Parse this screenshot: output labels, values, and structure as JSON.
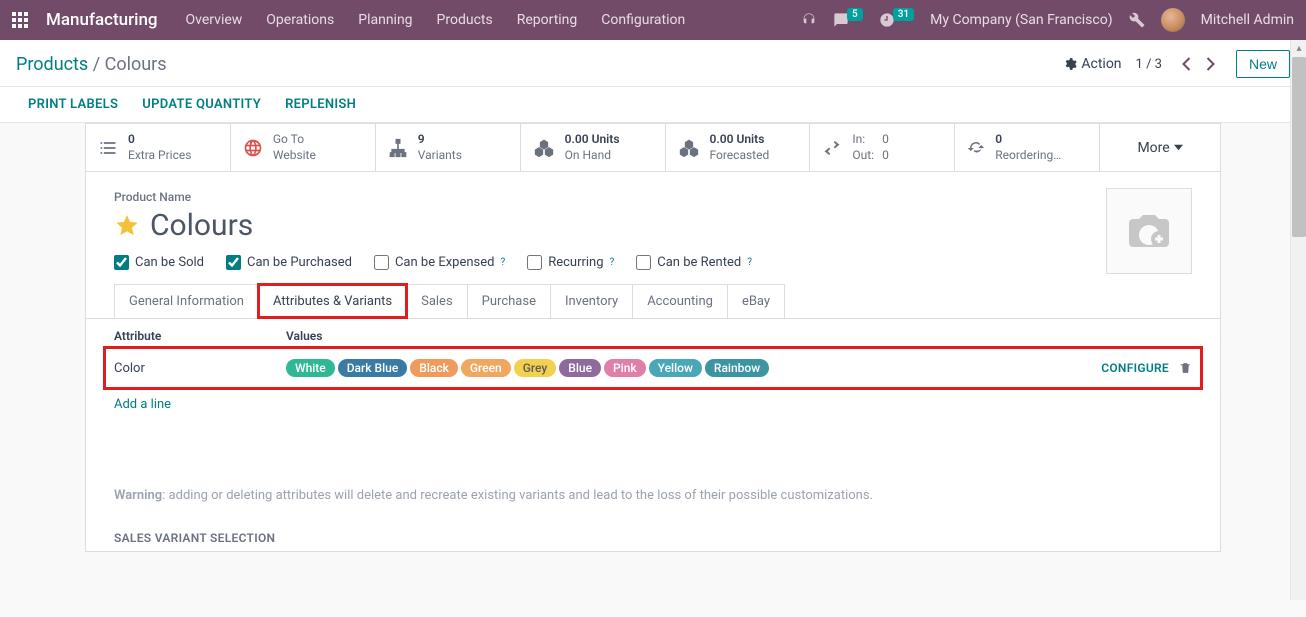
{
  "topbar": {
    "app": "Manufacturing",
    "menu": [
      "Overview",
      "Operations",
      "Planning",
      "Products",
      "Reporting",
      "Configuration"
    ],
    "chat_badge": "5",
    "clock_badge": "31",
    "company": "My Company (San Francisco)",
    "user": "Mitchell Admin"
  },
  "breadcrumb": {
    "parent": "Products",
    "current": "Colours"
  },
  "subbar": {
    "action": "Action",
    "pager": "1 / 3",
    "new": "New"
  },
  "actionbar": [
    "PRINT LABELS",
    "UPDATE QUANTITY",
    "REPLENISH"
  ],
  "stats": {
    "extra_prices": {
      "num": "0",
      "label": "Extra Prices"
    },
    "website": {
      "line1": "Go To",
      "line2": "Website"
    },
    "variants": {
      "num": "9",
      "label": "Variants"
    },
    "onhand": {
      "num": "0.00 Units",
      "label": "On Hand"
    },
    "forecast": {
      "num": "0.00 Units",
      "label": "Forecasted"
    },
    "inout": {
      "in_label": "In:",
      "in_val": "0",
      "out_label": "Out:",
      "out_val": "0"
    },
    "reorder": {
      "num": "0",
      "label": "Reordering…"
    },
    "more": "More"
  },
  "product": {
    "name_label": "Product Name",
    "name": "Colours",
    "checks": {
      "sold": "Can be Sold",
      "purchased": "Can be Purchased",
      "expensed": "Can be Expensed",
      "recurring": "Recurring",
      "rented": "Can be Rented"
    }
  },
  "tabs": [
    "General Information",
    "Attributes & Variants",
    "Sales",
    "Purchase",
    "Inventory",
    "Accounting",
    "eBay"
  ],
  "attributes": {
    "head_attr": "Attribute",
    "head_val": "Values",
    "row": {
      "name": "Color",
      "values": [
        {
          "t": "White",
          "bg": "#2fb894"
        },
        {
          "t": "Dark Blue",
          "bg": "#3a7ba6"
        },
        {
          "t": "Black",
          "bg": "#ef9b5c"
        },
        {
          "t": "Green",
          "bg": "#f0a860"
        },
        {
          "t": "Grey",
          "bg": "#f3d04e",
          "fg": "#5b5b5b"
        },
        {
          "t": "Blue",
          "bg": "#8f6a9e"
        },
        {
          "t": "Pink",
          "bg": "#e07fa8"
        },
        {
          "t": "Yellow",
          "bg": "#49a8b8"
        },
        {
          "t": "Rainbow",
          "bg": "#3d94a3"
        }
      ],
      "configure": "CONFIGURE"
    },
    "add": "Add a line"
  },
  "warning": {
    "label": "Warning",
    "text": ": adding or deleting attributes will delete and recreate existing variants and lead to the loss of their possible customizations."
  },
  "section": "SALES VARIANT SELECTION"
}
